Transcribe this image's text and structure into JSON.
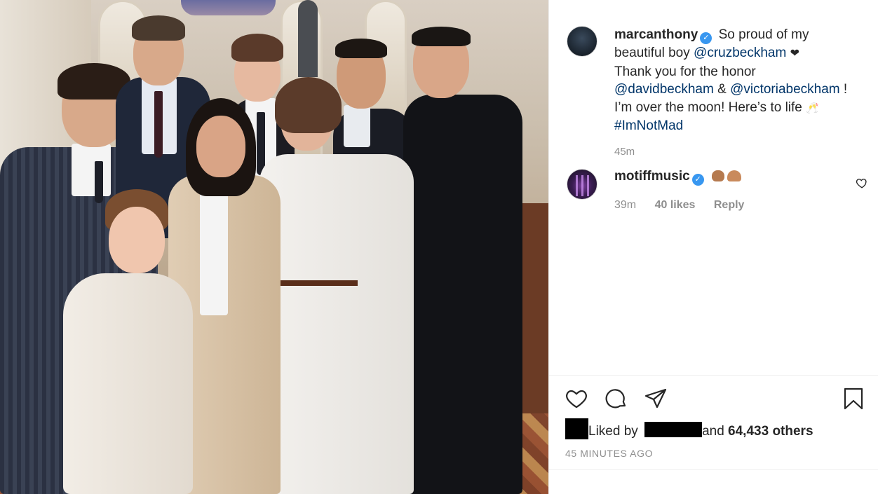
{
  "post": {
    "author": {
      "username": "marcanthony",
      "verified": true
    },
    "caption": {
      "text_1": "So proud of my beautiful boy",
      "mention_1": "@cruzbeckham",
      "text_2": "Thank you for the honor",
      "mention_2": "@davidbeckham",
      "amp": "&",
      "mention_3": "@victoriabeckham",
      "text_3": "!",
      "text_4": "I’m over the moon! Here’s to life",
      "hashtag": "#ImNotMad"
    },
    "caption_time": "45m",
    "comment": {
      "username": "motiffmusic",
      "verified": true,
      "emojis": [
        "flexed-biceps-emoji",
        "folded-hands-emoji"
      ],
      "time": "39m",
      "likes": "40 likes",
      "reply": "Reply"
    },
    "likes_summary": {
      "prefix": "Liked by",
      "middle": "and",
      "count": "64,433 others"
    },
    "timestamp": "45 MINUTES AGO",
    "actions": [
      "heart-icon",
      "comment-icon",
      "share-icon",
      "bookmark-icon"
    ],
    "colors": {
      "link": "#003569",
      "verified_badge": "#3897f0",
      "secondary_text": "#8e8e8e"
    }
  }
}
